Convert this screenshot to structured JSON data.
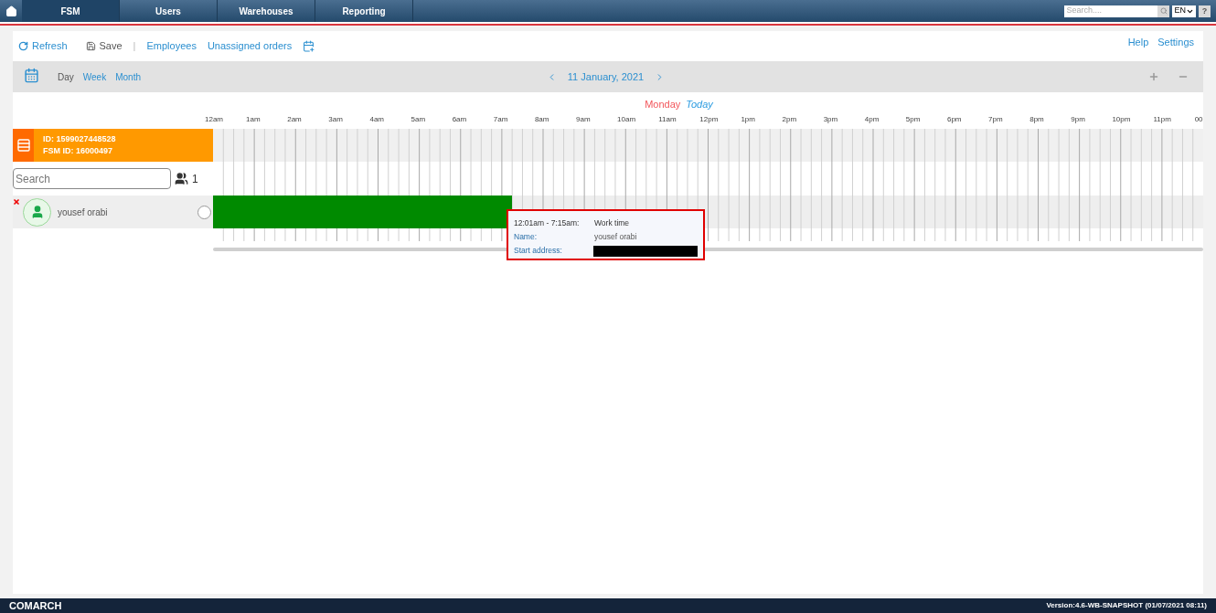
{
  "nav": {
    "tabs": [
      {
        "label": "FSM",
        "selected": true
      },
      {
        "label": "Users",
        "selected": false
      },
      {
        "label": "Warehouses",
        "selected": false
      },
      {
        "label": "Reporting",
        "selected": false
      }
    ],
    "search_placeholder": "Search....",
    "language": "EN",
    "help": "?"
  },
  "toolbar": {
    "refresh": "Refresh",
    "save": "Save",
    "separator": "|",
    "links": [
      "Employees",
      "Unassigned orders"
    ],
    "right_links": [
      "Help",
      "Settings"
    ]
  },
  "view_bar": {
    "views": [
      {
        "label": "Day",
        "selected": true
      },
      {
        "label": "Week",
        "selected": false
      },
      {
        "label": "Month",
        "selected": false
      }
    ],
    "date": "11 January, 2021"
  },
  "day_header": {
    "day": "Monday",
    "today": "Today"
  },
  "hours": [
    "12am",
    "1am",
    "2am",
    "3am",
    "4am",
    "5am",
    "6am",
    "7am",
    "8am",
    "9am",
    "10am",
    "11am",
    "12pm",
    "1pm",
    "2pm",
    "3pm",
    "4pm",
    "5pm",
    "6pm",
    "7pm",
    "8pm",
    "9pm",
    "10pm",
    "11pm",
    "00"
  ],
  "resource": {
    "id": "ID: 1599027448528",
    "fsm_id": "FSM ID: 16000497"
  },
  "employee_search": {
    "placeholder": "Search",
    "count": "1"
  },
  "employees": [
    {
      "name": "yousef orabi",
      "selected": false,
      "shift": {
        "level": 0.302,
        "color": "#008a00"
      }
    }
  ],
  "tooltip": {
    "time": "12:01am - 7:15am:",
    "title": "Work time",
    "fields": [
      {
        "kind": "text",
        "label": "Name:",
        "value": "yousef orabi"
      },
      {
        "kind": "redacted",
        "label": "Start address:"
      }
    ]
  },
  "footer": {
    "brand": "COMARCH",
    "version": "Version:4.6-WB-SNAPSHOT (01/07/2021 08:11)"
  }
}
